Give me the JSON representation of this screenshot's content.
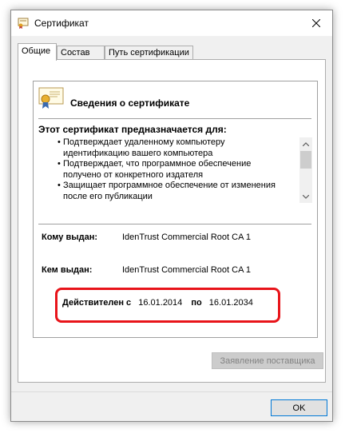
{
  "window": {
    "title": "Сертификат"
  },
  "tabs": [
    {
      "label": "Общие",
      "active": true
    },
    {
      "label": "Состав",
      "active": false
    },
    {
      "label": "Путь сертификации",
      "active": false
    }
  ],
  "cert": {
    "heading": "Сведения о сертификате",
    "purpose_title": "Этот сертификат предназначается для:",
    "bullet": "•",
    "purposes": [
      "Подтверждает удаленному компьютеру идентификацию вашего компьютера",
      "Подтверждает, что программное обеспечение получено от конкретного издателя",
      "Защищает программное обеспечение от  изменения после его публикации"
    ],
    "issued_to_label": "Кому выдан:",
    "issued_to_value": "IdenTrust Commercial Root CA 1",
    "issued_by_label": "Кем выдан:",
    "issued_by_value": "IdenTrust Commercial Root CA 1",
    "valid_from_label": "Действителен с",
    "valid_from": "16.01.2014",
    "valid_to_label": "по",
    "valid_to": "16.01.2034"
  },
  "buttons": {
    "vendor_statement": "Заявление поставщика",
    "ok": "OK"
  },
  "colors": {
    "highlight": "#e8141a",
    "focus": "#0078d7"
  },
  "icons": {
    "title": "certificate-icon",
    "close": "close-icon",
    "cert": "certificate-icon"
  }
}
